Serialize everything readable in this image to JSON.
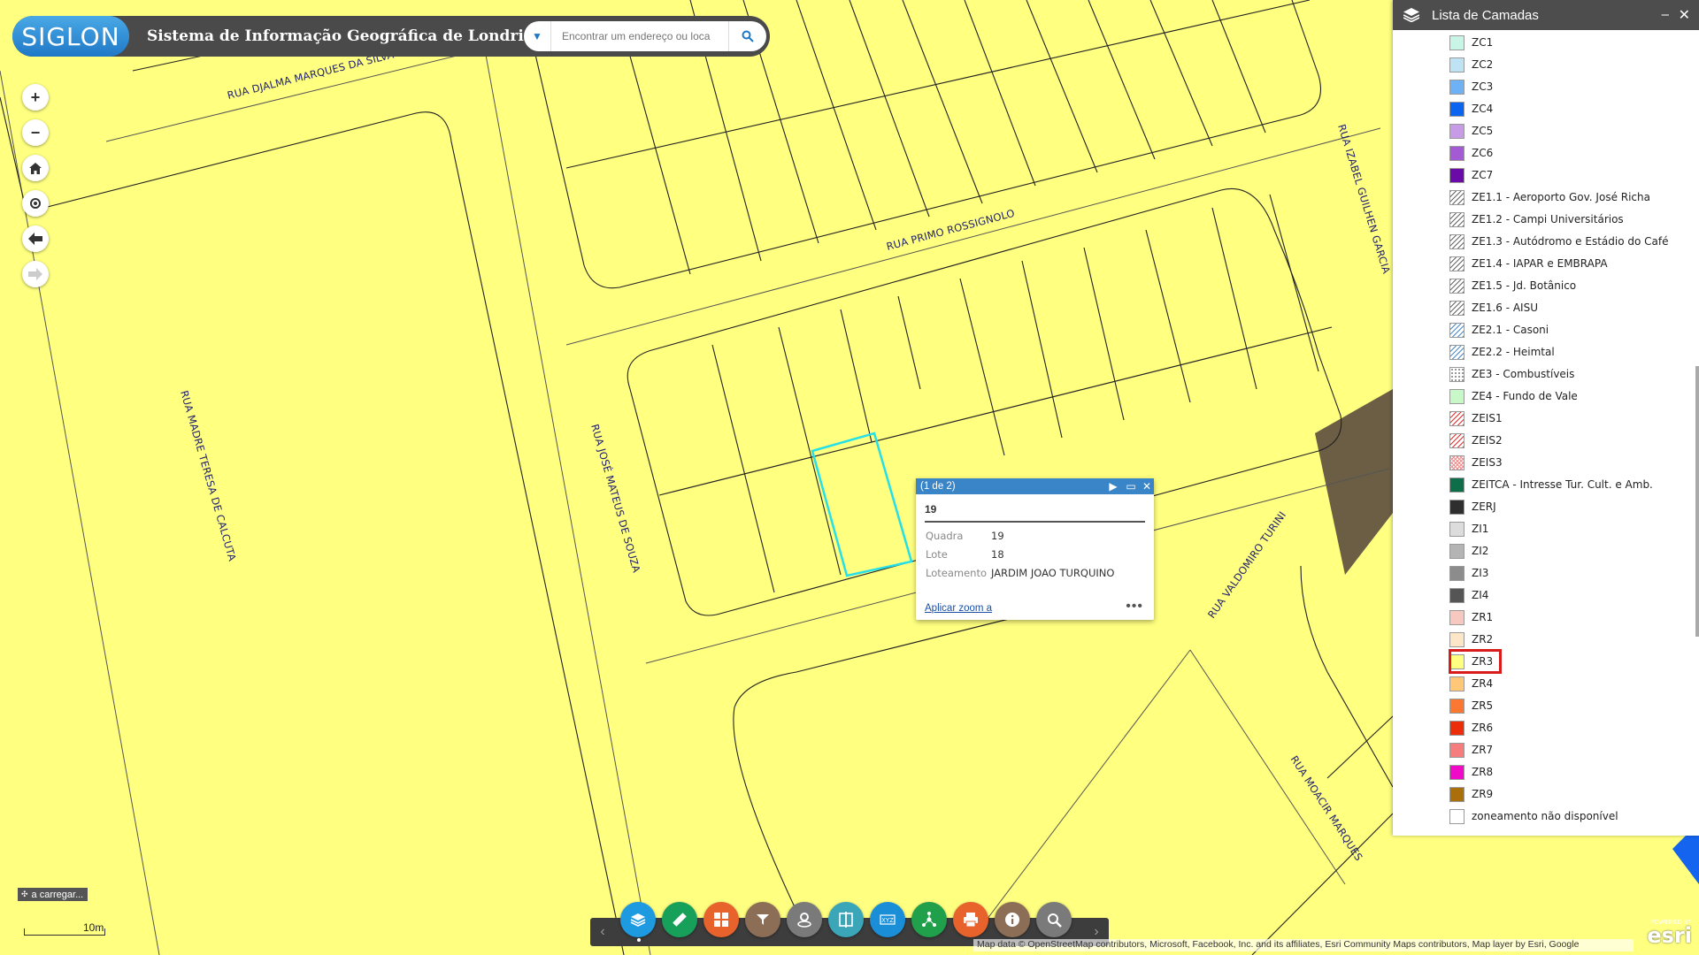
{
  "header": {
    "logo": "SIGLON",
    "title": "Sistema de Informação Geográfica de Londrina",
    "search_placeholder": "Encontrar um endereço ou loca"
  },
  "streets": [
    "RUA DJALMA MARQUES DA SILVA",
    "RUA PRIMO ROSSIGNOLO",
    "RUA IZABEL GUILHEN GARCIA",
    "RUA MADRE TERESA DE CALCUTA",
    "RUA JOSÉ MATEUS DE SOUZA",
    "RUA VALDOMIRO TURINI",
    "RUA MOACIR MARQUES"
  ],
  "layer_panel": {
    "title": "Lista de Camadas",
    "items": [
      {
        "label": "ZC1",
        "color": "#c8f5e6",
        "pattern": "solid"
      },
      {
        "label": "ZC2",
        "color": "#bde3f5",
        "pattern": "solid"
      },
      {
        "label": "ZC3",
        "color": "#6fb1f5",
        "pattern": "solid"
      },
      {
        "label": "ZC4",
        "color": "#0a64f0",
        "pattern": "solid"
      },
      {
        "label": "ZC5",
        "color": "#c89be6",
        "pattern": "solid"
      },
      {
        "label": "ZC6",
        "color": "#a35ad2",
        "pattern": "solid"
      },
      {
        "label": "ZC7",
        "color": "#6a0aa8",
        "pattern": "solid"
      },
      {
        "label": "ZE1.1 - Aeroporto Gov. José Richa",
        "color": "#ffffff",
        "pattern": "hatch"
      },
      {
        "label": "ZE1.2 - Campi Universitários",
        "color": "#ffffff",
        "pattern": "hatch"
      },
      {
        "label": "ZE1.3 - Autódromo e Estádio do Café",
        "color": "#ffffff",
        "pattern": "hatch"
      },
      {
        "label": "ZE1.4 - IAPAR e EMBRAPA",
        "color": "#ffffff",
        "pattern": "hatch"
      },
      {
        "label": "ZE1.5 - Jd. Botânico",
        "color": "#ffffff",
        "pattern": "hatch"
      },
      {
        "label": "ZE1.6 - AISU",
        "color": "#ffffff",
        "pattern": "hatch"
      },
      {
        "label": "ZE2.1 - Casoni",
        "color": "#ffffff",
        "pattern": "hatch-blue"
      },
      {
        "label": "ZE2.2 - Heimtal",
        "color": "#ffffff",
        "pattern": "hatch-blue"
      },
      {
        "label": "ZE3 - Combustíveis",
        "color": "#ffffff",
        "pattern": "dots"
      },
      {
        "label": "ZE4 - Fundo de Vale",
        "color": "#c8f7c8",
        "pattern": "solid"
      },
      {
        "label": "ZEIS1",
        "color": "#ffffff",
        "pattern": "hatch-red"
      },
      {
        "label": "ZEIS2",
        "color": "#ffffff",
        "pattern": "hatch-red"
      },
      {
        "label": "ZEIS3",
        "color": "#ffffff",
        "pattern": "hatch-pink"
      },
      {
        "label": "ZEITCA - Intresse Tur. Cult. e Amb.",
        "color": "#0f6e4a",
        "pattern": "solid"
      },
      {
        "label": "ZERJ",
        "color": "#2e2e2e",
        "pattern": "solid"
      },
      {
        "label": "ZI1",
        "color": "#dcdcdc",
        "pattern": "solid"
      },
      {
        "label": "ZI2",
        "color": "#b4b4b4",
        "pattern": "solid"
      },
      {
        "label": "ZI3",
        "color": "#8c8c8c",
        "pattern": "solid"
      },
      {
        "label": "ZI4",
        "color": "#555555",
        "pattern": "solid"
      },
      {
        "label": "ZR1",
        "color": "#f7c8c0",
        "pattern": "solid"
      },
      {
        "label": "ZR2",
        "color": "#fde6c8",
        "pattern": "solid"
      },
      {
        "label": "ZR3",
        "color": "#ffff80",
        "pattern": "solid"
      },
      {
        "label": "ZR4",
        "color": "#ffc878",
        "pattern": "solid"
      },
      {
        "label": "ZR5",
        "color": "#fa7832",
        "pattern": "solid"
      },
      {
        "label": "ZR6",
        "color": "#eb2d0a",
        "pattern": "solid"
      },
      {
        "label": "ZR7",
        "color": "#f57d7d",
        "pattern": "solid"
      },
      {
        "label": "ZR8",
        "color": "#f00ac8",
        "pattern": "solid"
      },
      {
        "label": "ZR9",
        "color": "#aa6e0a",
        "pattern": "solid"
      },
      {
        "label": "zoneamento não disponível",
        "color": "#ffffff",
        "pattern": "solid"
      }
    ]
  },
  "popup": {
    "counter": "(1 de 2)",
    "title": "19",
    "fields": [
      {
        "key": "Quadra",
        "value": "19"
      },
      {
        "key": "Lote",
        "value": "18"
      },
      {
        "key": "Loteamento",
        "value": "JARDIM JOAO TURQUINO"
      }
    ],
    "zoom_link": "Aplicar zoom a",
    "more": "•••"
  },
  "status": {
    "loading": "a carregar...",
    "scale": "10m",
    "attribution": "Map data © OpenStreetMap contributors, Microsoft, Facebook, Inc. and its affiliates, Esri Community Maps contributors, Map layer by Esri, Google",
    "esri_powered": "POWERED BY",
    "esri": "esri"
  },
  "colors": {
    "zone_fill": "#ffff80",
    "selection": "#26e0e8",
    "panel_header": "#4d4d4d",
    "popup_header": "#3a85c7",
    "highlight": "#d81b1b"
  },
  "toolbar": {
    "buttons": [
      {
        "name": "layers-button",
        "color": "#1e9ae0",
        "icon": "layers-icon"
      },
      {
        "name": "measure-button",
        "color": "#17a05a",
        "icon": "ruler-icon"
      },
      {
        "name": "basemap-button",
        "color": "#e8632c",
        "icon": "grid-icon"
      },
      {
        "name": "filter-button",
        "color": "#8c6e57",
        "icon": "filter-icon"
      },
      {
        "name": "location-button",
        "color": "#7a7a7a",
        "icon": "pin-icon"
      },
      {
        "name": "compare-button",
        "color": "#3aa6b8",
        "icon": "split-icon"
      },
      {
        "name": "coordinates-button",
        "color": "#1a8fd8",
        "icon": "xyz-icon"
      },
      {
        "name": "share-button",
        "color": "#20a04a",
        "icon": "share-icon"
      },
      {
        "name": "print-button",
        "color": "#e8632c",
        "icon": "printer-icon"
      },
      {
        "name": "about-button",
        "color": "#8c6e57",
        "icon": "info-icon"
      },
      {
        "name": "query-button",
        "color": "#7a7a7a",
        "icon": "search-map-icon"
      }
    ]
  }
}
